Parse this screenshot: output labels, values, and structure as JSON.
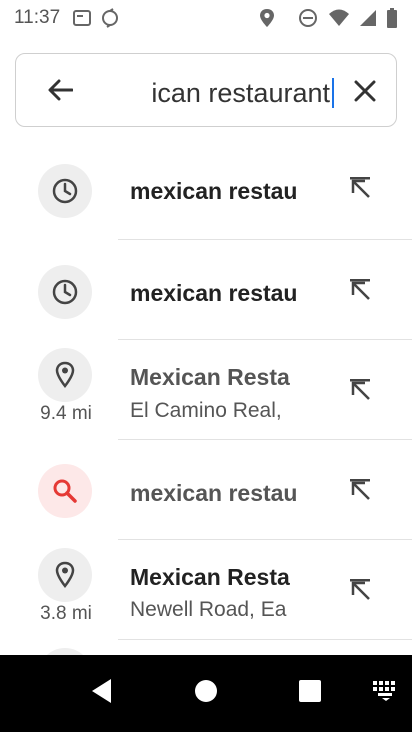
{
  "status": {
    "time": "11:37"
  },
  "search": {
    "query": "ican restaurant"
  },
  "suggestions": [
    {
      "type": "history",
      "icon": "history-icon",
      "title": "mexican restau",
      "subtitle": "",
      "distance": "",
      "light": false
    },
    {
      "type": "history",
      "icon": "history-icon",
      "title": "mexican restau",
      "subtitle": "",
      "distance": "",
      "light": false
    },
    {
      "type": "place",
      "icon": "location-pin-icon",
      "title": "Mexican Resta",
      "subtitle": "El Camino Real,",
      "distance": "9.4 mi",
      "light": true
    },
    {
      "type": "search",
      "icon": "search-icon",
      "title": "mexican restau",
      "subtitle": "",
      "distance": "",
      "light": true
    },
    {
      "type": "place",
      "icon": "location-pin-icon",
      "title": "Mexican Resta",
      "subtitle": "Newell Road, Ea",
      "distance": "3.8 mi",
      "light": false
    }
  ],
  "colors": {
    "accent": "#1a73e8",
    "search_red": "#e53935"
  }
}
